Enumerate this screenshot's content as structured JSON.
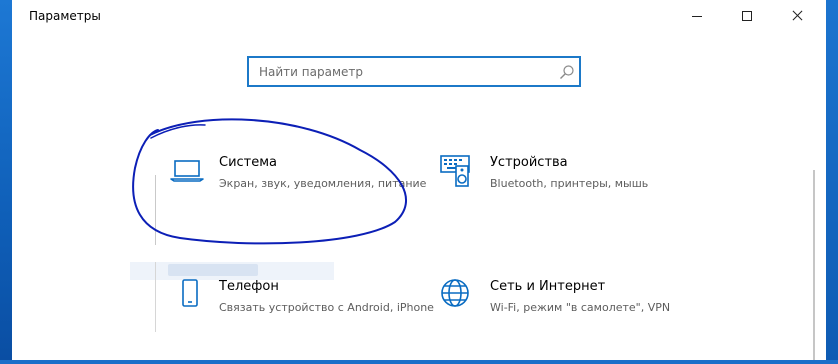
{
  "window": {
    "title": "Параметры"
  },
  "search": {
    "placeholder": "Найти параметр",
    "value": "",
    "icon": "search-icon"
  },
  "tiles": [
    {
      "title": "Система",
      "description": "Экран, звук, уведомления, питание",
      "icon": "laptop-icon"
    },
    {
      "title": "Устройства",
      "description": "Bluetooth, принтеры, мышь",
      "icon": "keyboard-speaker-icon"
    },
    {
      "title": "Телефон",
      "description": "Связать устройство с Android, iPhone",
      "icon": "phone-icon"
    },
    {
      "title": "Сеть и Интернет",
      "description": "Wi-Fi, режим \"в самолете\", VPN",
      "icon": "globe-icon"
    }
  ],
  "colors": {
    "accent": "#0a6cc2",
    "ink_annotation": "#0c1fb6",
    "search_border": "#1c79c8",
    "desktop": "#1a6fc9"
  }
}
